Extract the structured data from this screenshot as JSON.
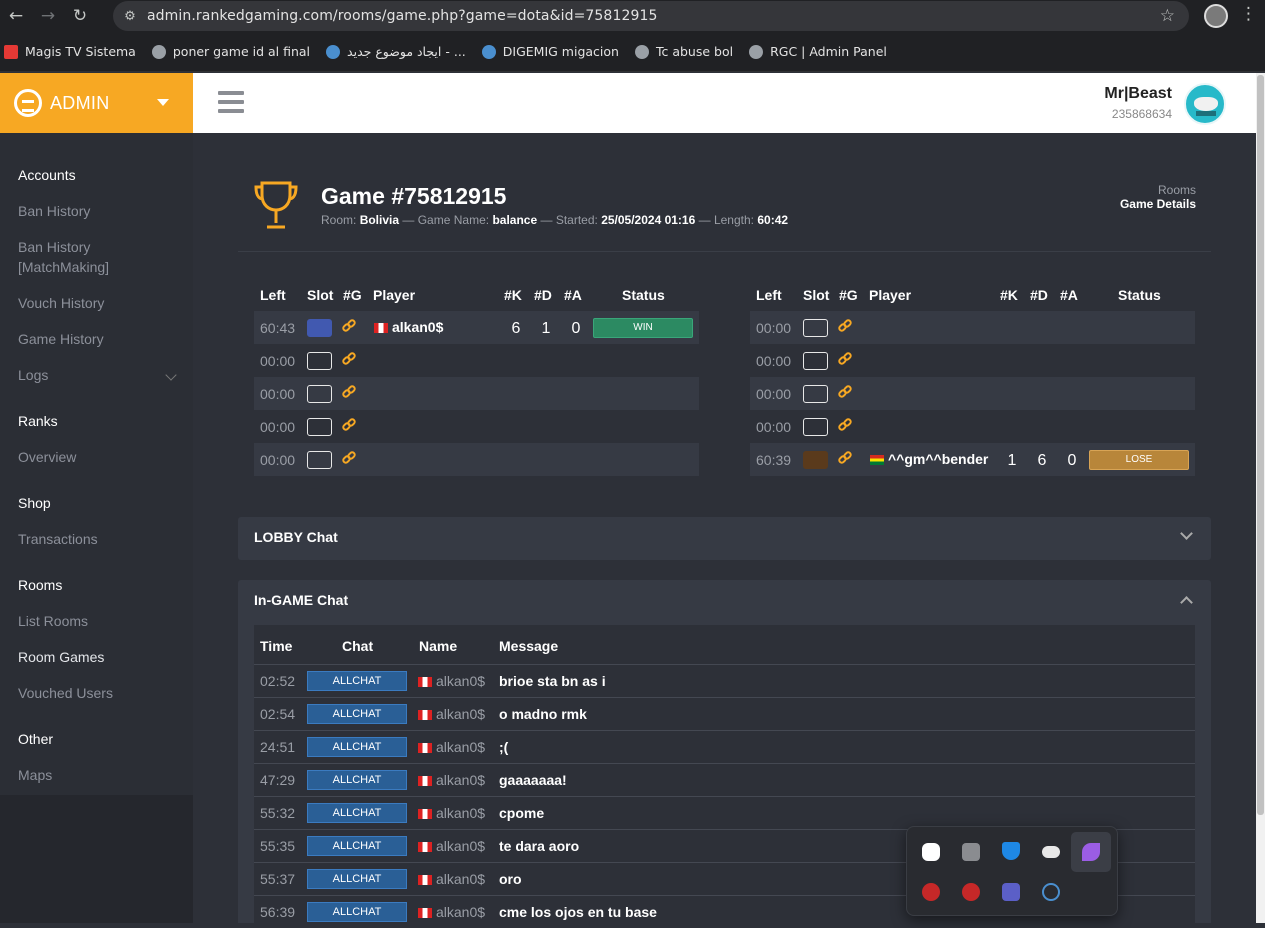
{
  "browser": {
    "url": "admin.rankedgaming.com/rooms/game.php?game=dota&id=75812915",
    "bookmarks": [
      {
        "label": "Magis TV Sistema",
        "icon": "tv-icon"
      },
      {
        "label": "poner game id al final",
        "icon": "globe-icon"
      },
      {
        "label": "ايجاد موضوع جديد - ...",
        "icon": "edge-icon"
      },
      {
        "label": "DIGEMIG migacion",
        "icon": "shield-icon"
      },
      {
        "label": "Tc abuse bol",
        "icon": "gear-icon"
      },
      {
        "label": "RGC | Admin Panel",
        "icon": "globe-icon"
      }
    ]
  },
  "brand": {
    "label": "ADMIN"
  },
  "user": {
    "name": "Mr|Beast",
    "id": "235868634"
  },
  "sidebar": {
    "sections": [
      {
        "title": "Accounts",
        "items": [
          "Ban History",
          "Ban History [MatchMaking]",
          "Vouch History",
          "Game History",
          "Logs"
        ]
      },
      {
        "title": "Ranks",
        "items": [
          "Overview"
        ]
      },
      {
        "title": "Shop",
        "items": [
          "Transactions"
        ]
      },
      {
        "title": "Rooms",
        "items": [
          "List Rooms",
          "Room Games",
          "Vouched Users"
        ]
      },
      {
        "title": "Other",
        "items": [
          "Maps"
        ]
      }
    ]
  },
  "game": {
    "title": "Game #75812915",
    "room_label": "Room:",
    "room": "Bolivia",
    "name_label": "— Game Name:",
    "name": "balance",
    "started_label": "— Started:",
    "started": "25/05/2024 01:16",
    "length_label": "— Length:",
    "length": "60:42"
  },
  "breadcrumb": {
    "parent": "Rooms",
    "current": "Game Details"
  },
  "team_headers": {
    "left": "Left",
    "slot": "Slot",
    "g": "#G",
    "player": "Player",
    "k": "#K",
    "d": "#D",
    "a": "#A",
    "status": "Status"
  },
  "teams": [
    {
      "players": [
        {
          "left": "60:43",
          "slot_color": "#4159b0",
          "flag": "pe",
          "name": "alkan0$",
          "k": "6",
          "d": "1",
          "a": "0",
          "status": "WIN"
        },
        {
          "left": "00:00"
        },
        {
          "left": "00:00"
        },
        {
          "left": "00:00"
        },
        {
          "left": "00:00"
        }
      ]
    },
    {
      "players": [
        {
          "left": "00:00"
        },
        {
          "left": "00:00"
        },
        {
          "left": "00:00"
        },
        {
          "left": "00:00"
        },
        {
          "left": "60:39",
          "slot_color": "#5a3a1c",
          "flag": "bo",
          "name": "^^gm^^bender",
          "k": "1",
          "d": "6",
          "a": "0",
          "status": "LOSE"
        }
      ]
    }
  ],
  "lobby_chat": {
    "title": "LOBBY Chat"
  },
  "ingame_chat": {
    "title": "In-GAME Chat",
    "headers": {
      "time": "Time",
      "chat": "Chat",
      "name": "Name",
      "message": "Message"
    },
    "rows": [
      {
        "time": "02:52",
        "chat": "ALLCHAT",
        "name": "alkan0$",
        "message": "brioe sta bn as i"
      },
      {
        "time": "02:54",
        "chat": "ALLCHAT",
        "name": "alkan0$",
        "message": "o madno rmk"
      },
      {
        "time": "24:51",
        "chat": "ALLCHAT",
        "name": "alkan0$",
        "message": ";("
      },
      {
        "time": "47:29",
        "chat": "ALLCHAT",
        "name": "alkan0$",
        "message": "gaaaaaaa!"
      },
      {
        "time": "55:32",
        "chat": "ALLCHAT",
        "name": "alkan0$",
        "message": "cpome"
      },
      {
        "time": "55:35",
        "chat": "ALLCHAT",
        "name": "alkan0$",
        "message": "te dara aoro"
      },
      {
        "time": "55:37",
        "chat": "ALLCHAT",
        "name": "alkan0$",
        "message": "oro"
      },
      {
        "time": "56:39",
        "chat": "ALLCHAT",
        "name": "alkan0$",
        "message": "cme los ojos en tu base"
      }
    ]
  },
  "tray_icons": [
    "discord-icon",
    "folder-icon",
    "defender-icon",
    "onedrive-icon",
    "feather-icon",
    "app-red-icon",
    "app-red-icon",
    "teams-icon",
    "edge-icon"
  ],
  "colors": {
    "accent": "#f7a823",
    "win": "#2c8a62",
    "lose": "#b8863a",
    "allchat": "#2a5f96"
  }
}
